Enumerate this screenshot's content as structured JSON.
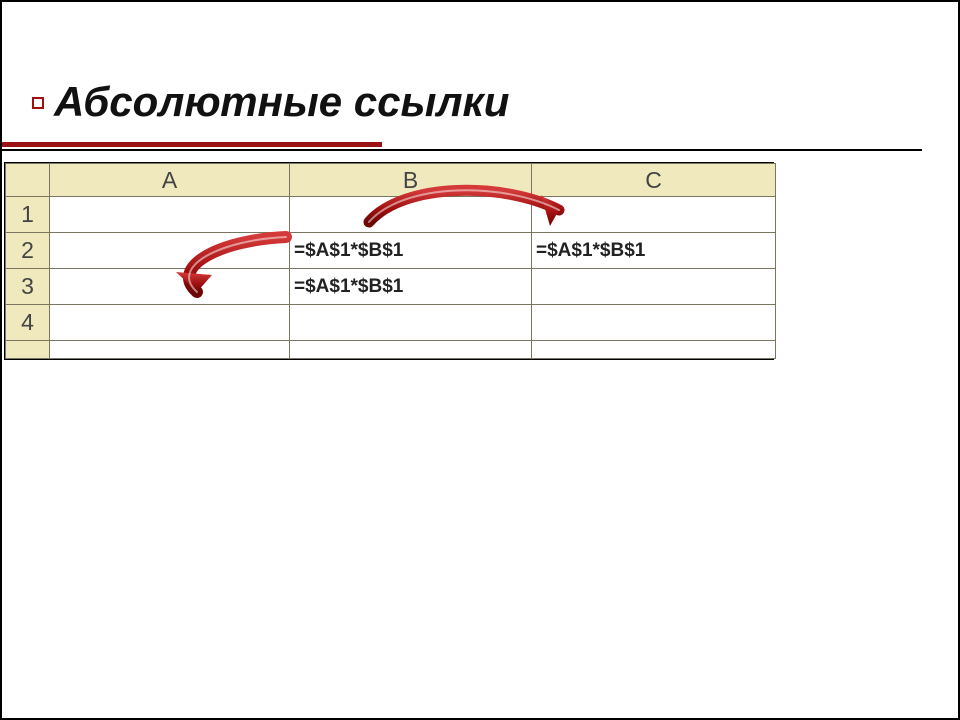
{
  "title": "Абсолютные ссылки",
  "columns": {
    "A": "A",
    "B": "B",
    "C": "C"
  },
  "rows": [
    "1",
    "2",
    "3",
    "4"
  ],
  "cells": {
    "B2": "=$A$1*$B$1",
    "C2": "=$A$1*$B$1",
    "B3": "=$A$1*$B$1"
  },
  "colors": {
    "accent": "#9b1313",
    "arrow": "#a00f0f"
  }
}
